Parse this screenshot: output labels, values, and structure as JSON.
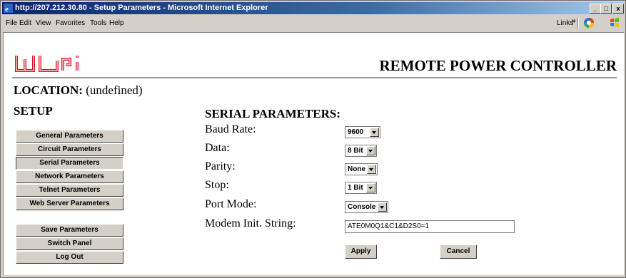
{
  "window": {
    "title": "http://207.212.30.80 - Setup Parameters - Microsoft Internet Explorer",
    "minimize": "_",
    "maximize": "□",
    "close": "x"
  },
  "menubar": {
    "items": [
      "File",
      "Edit",
      "View",
      "Favorites",
      "Tools",
      "Help"
    ],
    "links_label": "Links",
    "links_chevron": "»"
  },
  "header": {
    "logo_text": "wti",
    "product_title": "REMOTE POWER CONTROLLER",
    "location_label": "LOCATION:",
    "location_value": "(undefined)"
  },
  "sidebar": {
    "heading": "SETUP",
    "setup_buttons": [
      "General Parameters",
      "Circuit Parameters",
      "Serial Parameters",
      "Network Parameters",
      "Telnet Parameters",
      "Web Server Parameters"
    ],
    "action_buttons": [
      "Save Parameters",
      "Switch Panel",
      "Log Out"
    ]
  },
  "form": {
    "heading": "SERIAL PARAMETERS:",
    "baud_rate": {
      "label": "Baud Rate:",
      "value": "9600"
    },
    "data": {
      "label": "Data:",
      "value": "8 Bit"
    },
    "parity": {
      "label": "Parity:",
      "value": "None"
    },
    "stop": {
      "label": "Stop:",
      "value": "1 Bit"
    },
    "port_mode": {
      "label": "Port Mode:",
      "value": "Console"
    },
    "modem_init": {
      "label": "Modem Init. String:",
      "value": "ATE0M0Q1&C1&D2S0=1"
    },
    "apply_label": "Apply",
    "cancel_label": "Cancel"
  }
}
